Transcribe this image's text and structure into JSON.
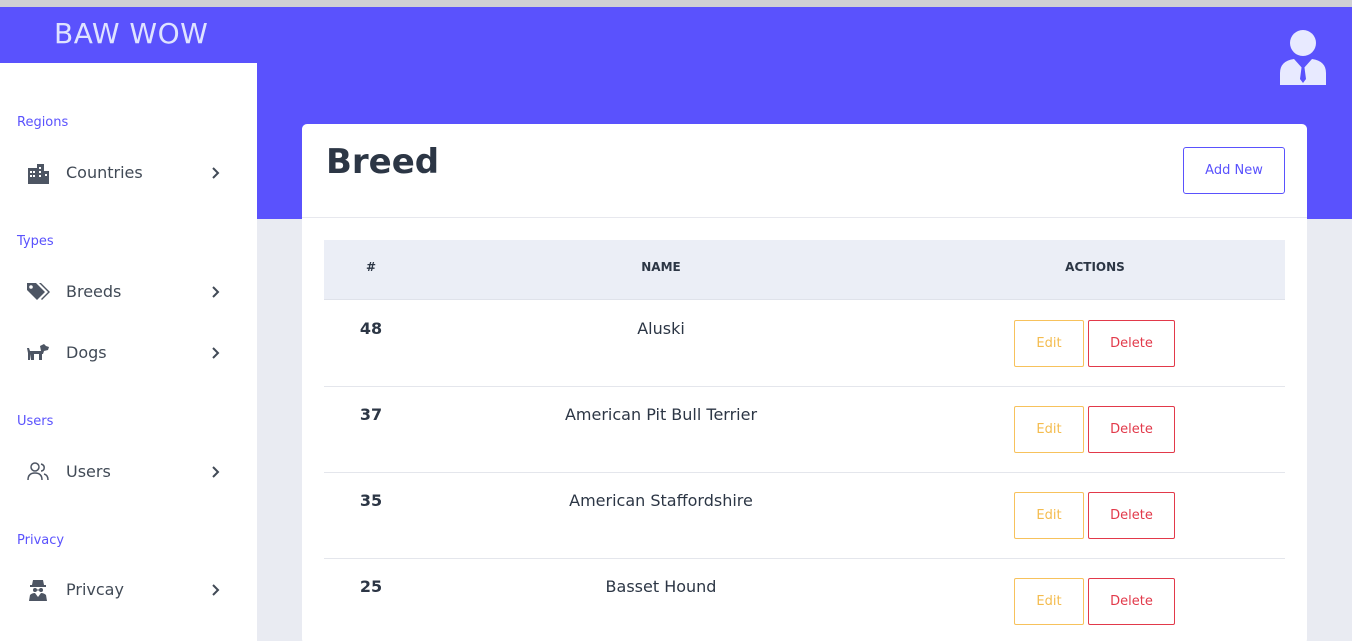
{
  "app": {
    "brand": "BAW WOW"
  },
  "sidebar": {
    "sections": [
      {
        "label": "Regions",
        "items": [
          {
            "label": "Countries",
            "icon": "city-icon"
          }
        ]
      },
      {
        "label": "Types",
        "items": [
          {
            "label": "Breeds",
            "icon": "tags-icon"
          },
          {
            "label": "Dogs",
            "icon": "dog-icon"
          }
        ]
      },
      {
        "label": "Users",
        "items": [
          {
            "label": "Users",
            "icon": "users-icon"
          }
        ]
      },
      {
        "label": "Privacy",
        "items": [
          {
            "label": "Privcay",
            "icon": "user-secret-icon"
          }
        ]
      }
    ]
  },
  "page": {
    "title": "Breed",
    "add_button": "Add New"
  },
  "table": {
    "headers": [
      "#",
      "NAME",
      "ACTIONS"
    ],
    "rows": [
      {
        "id": "48",
        "name": "Aluski",
        "edit": "Edit",
        "delete": "Delete"
      },
      {
        "id": "37",
        "name": "American Pit Bull Terrier",
        "edit": "Edit",
        "delete": "Delete"
      },
      {
        "id": "35",
        "name": "American Staffordshire",
        "edit": "Edit",
        "delete": "Delete"
      },
      {
        "id": "25",
        "name": "Basset Hound",
        "edit": "Edit",
        "delete": "Delete"
      }
    ]
  },
  "colors": {
    "primary": "#5a52fd",
    "warning": "#f4bc4f",
    "danger": "#e2394a",
    "text": "#2c3645"
  }
}
